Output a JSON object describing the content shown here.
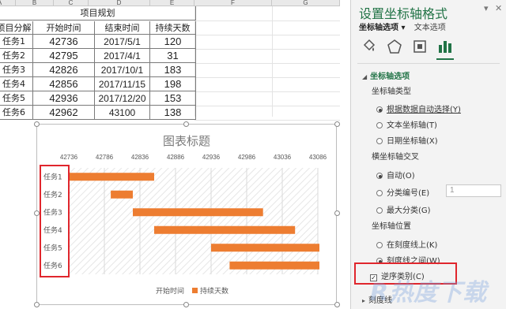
{
  "sheet": {
    "col_headers": [
      "A",
      "B",
      "C",
      "D",
      "E",
      "F",
      "G"
    ],
    "table_title": "项目规划",
    "headers": [
      "项目分解",
      "开始时间",
      "结束时间",
      "持续天数"
    ],
    "rows": [
      [
        "任务1",
        "42736",
        "2017/5/1",
        "120"
      ],
      [
        "任务2",
        "42795",
        "2017/4/1",
        "31"
      ],
      [
        "任务3",
        "42826",
        "2017/10/1",
        "183"
      ],
      [
        "任务4",
        "42856",
        "2017/11/15",
        "198"
      ],
      [
        "任务5",
        "42936",
        "2017/12/20",
        "153"
      ],
      [
        "任务6",
        "42962",
        "43100",
        "138"
      ]
    ]
  },
  "chart_data": {
    "type": "bar",
    "title": "图表标题",
    "categories": [
      "任务1",
      "任务2",
      "任务3",
      "任务4",
      "任务5",
      "任务6"
    ],
    "x_ticks": [
      "42736",
      "42786",
      "42836",
      "42886",
      "42936",
      "42986",
      "43036",
      "43086"
    ],
    "xlim": [
      42736,
      43086
    ],
    "series": [
      {
        "name": "开始时间",
        "values": [
          42736,
          42795,
          42826,
          42856,
          42936,
          42962
        ],
        "color": "none"
      },
      {
        "name": "持续天数",
        "values": [
          120,
          31,
          183,
          198,
          153,
          138
        ],
        "color": "#ed7d31"
      }
    ],
    "stacked": true,
    "orientation": "horizontal",
    "grid": true,
    "legend_position": "bottom"
  },
  "panel": {
    "title": "设置坐标轴格式",
    "tabs": [
      "坐标轴选项",
      "文本选项"
    ],
    "section_axis_options": "坐标轴选项",
    "axis_type_label": "坐标轴类型",
    "axis_type_options": [
      "根据数据自动选择(Y)",
      "文本坐标轴(T)",
      "日期坐标轴(X)"
    ],
    "cross_label": "横坐标轴交叉",
    "cross_options": [
      "自动(O)",
      "分类编号(E)",
      "最大分类(G)"
    ],
    "cross_input_value": "1",
    "position_label": "坐标轴位置",
    "position_options": [
      "在刻度线上(K)",
      "刻度线之间(W)"
    ],
    "reverse_label": "逆序类别(C)",
    "tick_section": "刻度线",
    "accent_color": "#217346"
  },
  "watermark": "R热度下载"
}
